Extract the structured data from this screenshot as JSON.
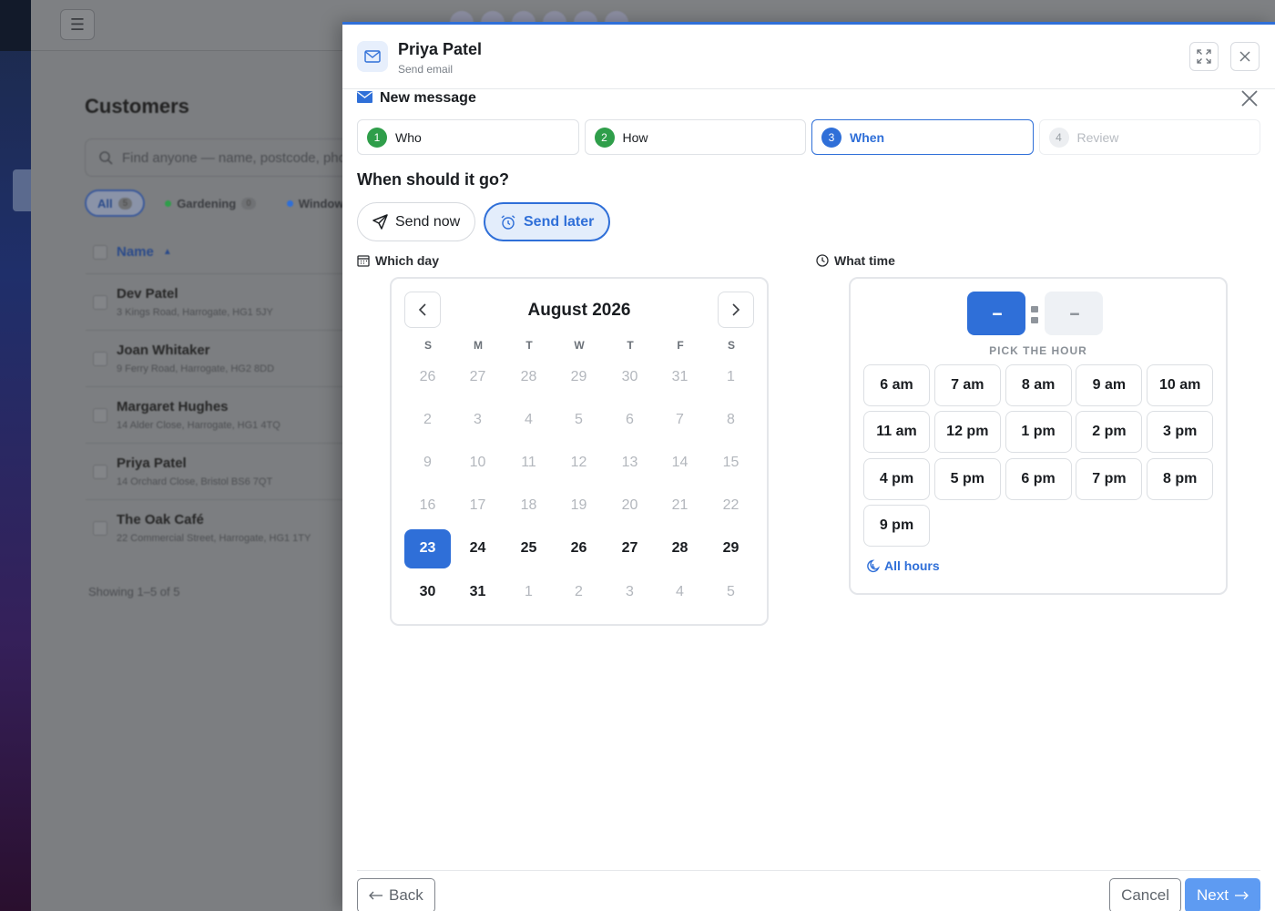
{
  "background": {
    "title": "Customers",
    "search_placeholder": "Find anyone — name, postcode, phone",
    "chips": [
      {
        "label": "All",
        "count": "5",
        "color": ""
      },
      {
        "label": "Gardening",
        "count": "0",
        "color": "#2f9e4a"
      },
      {
        "label": "Windows",
        "count": "",
        "color": "#2f6fd8"
      }
    ],
    "column_name": "Name",
    "rows": [
      {
        "name": "Dev Patel",
        "address": "3 Kings Road, Harrogate, HG1 5JY"
      },
      {
        "name": "Joan Whitaker",
        "address": "9 Ferry Road, Harrogate, HG2 8DD"
      },
      {
        "name": "Margaret Hughes",
        "address": "14 Alder Close, Harrogate, HG1 4TQ"
      },
      {
        "name": "Priya Patel",
        "address": "14 Orchard Close, Bristol BS6 7QT"
      },
      {
        "name": "The Oak Café",
        "address": "22 Commercial Street, Harrogate, HG1 1TY"
      }
    ],
    "footer": "Showing 1–5 of 5"
  },
  "panel": {
    "name": "Priya Patel",
    "subtitle": "Send email",
    "message_title": "New message",
    "steps": [
      {
        "num": "1",
        "label": "Who",
        "state": "done"
      },
      {
        "num": "2",
        "label": "How",
        "state": "done"
      },
      {
        "num": "3",
        "label": "When",
        "state": "active"
      },
      {
        "num": "4",
        "label": "Review",
        "state": "todo"
      }
    ],
    "question": "When should it go?",
    "send_now": "Send now",
    "send_later": "Send later",
    "which_day": "Which day",
    "what_time": "What time",
    "calendar": {
      "month": "August 2026",
      "weekdays": [
        "S",
        "M",
        "T",
        "W",
        "T",
        "F",
        "S"
      ],
      "selected": "23",
      "days": [
        [
          "26",
          "27",
          "28",
          "29",
          "30",
          "31",
          "1"
        ],
        [
          "2",
          "3",
          "4",
          "5",
          "6",
          "7",
          "8"
        ],
        [
          "9",
          "10",
          "11",
          "12",
          "13",
          "14",
          "15"
        ],
        [
          "16",
          "17",
          "18",
          "19",
          "20",
          "21",
          "22"
        ],
        [
          "23",
          "24",
          "25",
          "26",
          "27",
          "28",
          "29"
        ],
        [
          "30",
          "31",
          "1",
          "2",
          "3",
          "4",
          "5"
        ]
      ],
      "enabled_from": [
        4,
        0
      ],
      "enabled_to": [
        5,
        1
      ]
    },
    "time": {
      "hour_display": "--",
      "minute_display": "--",
      "pick_label": "PICK THE HOUR",
      "hours": [
        "6 am",
        "7 am",
        "8 am",
        "9 am",
        "10 am",
        "11 am",
        "12 pm",
        "1 pm",
        "2 pm",
        "3 pm",
        "4 pm",
        "5 pm",
        "6 pm",
        "7 pm",
        "8 pm",
        "9 pm"
      ],
      "all_hours": "All hours"
    },
    "back": "Back",
    "cancel": "Cancel",
    "next": "Next"
  }
}
